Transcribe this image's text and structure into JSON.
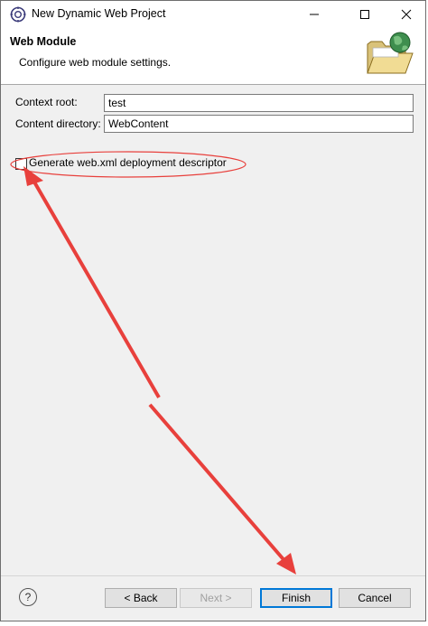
{
  "window": {
    "title": "New Dynamic Web Project"
  },
  "banner": {
    "title": "Web Module",
    "description": "Configure web module settings."
  },
  "form": {
    "context_root_label": "Context root:",
    "context_root_value": "test",
    "content_dir_label": "Content directory:",
    "content_dir_value": "WebContent",
    "generate_xml_label": "Generate web.xml deployment descriptor",
    "generate_xml_checked": false
  },
  "buttons": {
    "help": "?",
    "back": "< Back",
    "next": "Next >",
    "finish": "Finish",
    "cancel": "Cancel"
  },
  "icons": {
    "app": "eclipse-gear-icon",
    "banner": "folder-globe-icon",
    "minimize": "minimize-icon",
    "maximize": "maximize-icon",
    "close": "close-icon"
  },
  "colors": {
    "annotation": "#e8403c",
    "default_button_border": "#0078d7"
  }
}
